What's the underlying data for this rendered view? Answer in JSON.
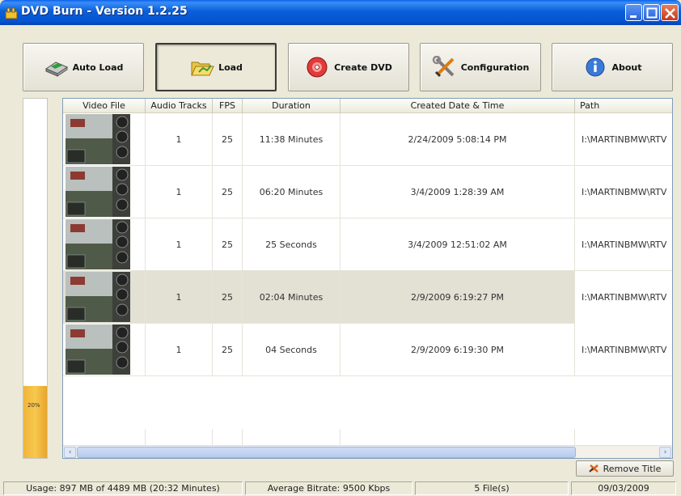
{
  "window": {
    "title": "DVD Burn - Version 1.2.25"
  },
  "toolbar": {
    "auto_load_label": "Auto Load",
    "load_label": "Load",
    "create_dvd_label": "Create DVD",
    "configuration_label": "Configuration",
    "about_label": "About"
  },
  "progress": {
    "label": "20%",
    "fraction": 0.2
  },
  "grid": {
    "columns": [
      "Video File",
      "Audio Tracks",
      "FPS",
      "Duration",
      "Created Date & Time",
      "Path"
    ],
    "rows": [
      {
        "audio_tracks": "1",
        "fps": "25",
        "duration": "11:38 Minutes",
        "created": "2/24/2009 5:08:14 PM",
        "path": "I:\\MARTINBMW\\RTV"
      },
      {
        "audio_tracks": "1",
        "fps": "25",
        "duration": "06:20 Minutes",
        "created": "3/4/2009 1:28:39 AM",
        "path": "I:\\MARTINBMW\\RTV"
      },
      {
        "audio_tracks": "1",
        "fps": "25",
        "duration": "25 Seconds",
        "created": "3/4/2009 12:51:02 AM",
        "path": "I:\\MARTINBMW\\RTV"
      },
      {
        "audio_tracks": "1",
        "fps": "25",
        "duration": "02:04 Minutes",
        "created": "2/9/2009 6:19:27 PM",
        "path": "I:\\MARTINBMW\\RTV",
        "selected": true
      },
      {
        "audio_tracks": "1",
        "fps": "25",
        "duration": "04 Seconds",
        "created": "2/9/2009 6:19:30 PM",
        "path": "I:\\MARTINBMW\\RTV"
      }
    ]
  },
  "actions": {
    "remove_title_label": "Remove Title"
  },
  "status": {
    "usage": "Usage: 897 MB of 4489 MB (20:32 Minutes)",
    "bitrate": "Average Bitrate: 9500 Kbps",
    "files": "5 File(s)",
    "date": "09/03/2009"
  },
  "colors": {
    "titlebar": "#0a5fd9",
    "progress_fill": "#f7c84f",
    "selection": "#e3e0d4"
  }
}
